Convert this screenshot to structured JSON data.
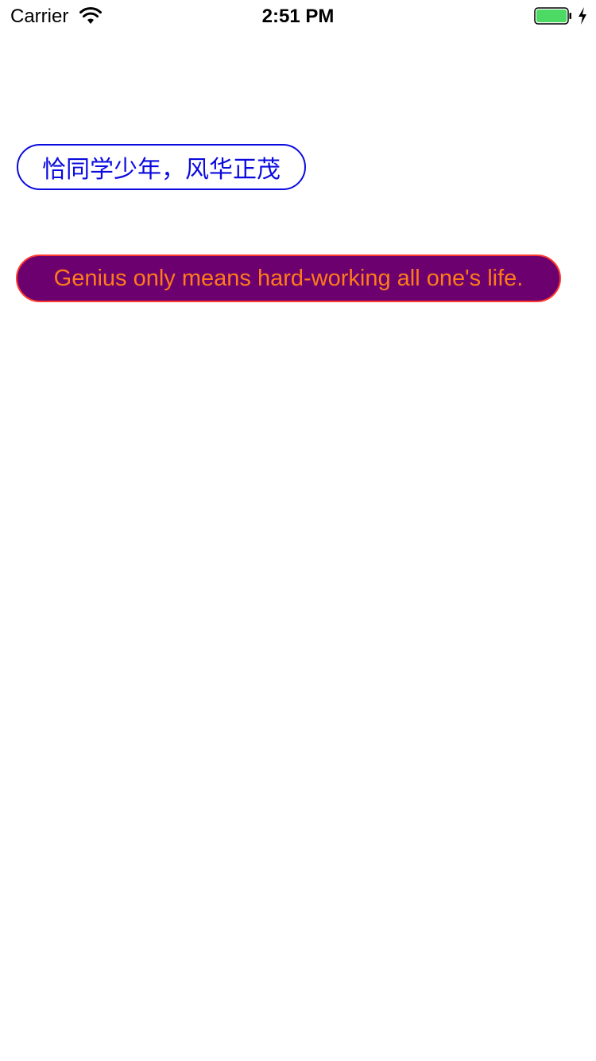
{
  "status_bar": {
    "carrier": "Carrier",
    "time": "2:51 PM",
    "battery_color": "#4cd964"
  },
  "labels": {
    "chinese_label": "恰同学少年，风华正茂",
    "english_label": "Genius only means hard-working all one's life."
  },
  "colors": {
    "chinese_label_text": "#0a0adf",
    "chinese_label_border": "#0a0adf",
    "english_label_background": "#6b006e",
    "english_label_text": "#ff7a1a",
    "english_label_border": "#ff3b2f"
  }
}
